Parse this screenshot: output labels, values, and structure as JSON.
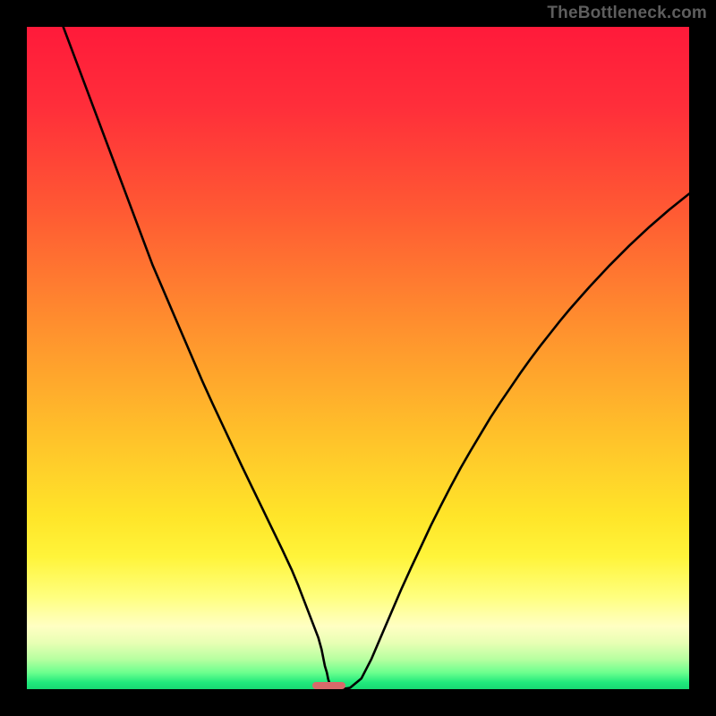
{
  "brand_text": "TheBottleneck.com",
  "colors": {
    "frame": "#000000",
    "curve_stroke": "#000000",
    "marker_fill": "#d86a6a",
    "brand_text": "#5e5e5e",
    "gradient_stops": [
      {
        "offset": 0.0,
        "color": "#ff1a3a"
      },
      {
        "offset": 0.12,
        "color": "#ff2e3a"
      },
      {
        "offset": 0.28,
        "color": "#ff5a33"
      },
      {
        "offset": 0.45,
        "color": "#ff8f2e"
      },
      {
        "offset": 0.62,
        "color": "#ffc22a"
      },
      {
        "offset": 0.74,
        "color": "#ffe529"
      },
      {
        "offset": 0.8,
        "color": "#fff43a"
      },
      {
        "offset": 0.86,
        "color": "#ffff7e"
      },
      {
        "offset": 0.905,
        "color": "#ffffc3"
      },
      {
        "offset": 0.93,
        "color": "#e8ffb4"
      },
      {
        "offset": 0.955,
        "color": "#b6ffa0"
      },
      {
        "offset": 0.975,
        "color": "#6cff8e"
      },
      {
        "offset": 0.99,
        "color": "#20e97c"
      },
      {
        "offset": 1.0,
        "color": "#18d973"
      }
    ]
  },
  "chart_data": {
    "type": "line",
    "title": "",
    "xlabel": "",
    "ylabel": "",
    "xlim": [
      0,
      1
    ],
    "ylim": [
      0,
      1
    ],
    "x": [
      0.055,
      0.07,
      0.085,
      0.1,
      0.115,
      0.13,
      0.145,
      0.16,
      0.175,
      0.19,
      0.205,
      0.22,
      0.235,
      0.25,
      0.265,
      0.28,
      0.295,
      0.31,
      0.325,
      0.34,
      0.355,
      0.37,
      0.385,
      0.4,
      0.41,
      0.415,
      0.42,
      0.425,
      0.43,
      0.435,
      0.44,
      0.445,
      0.448,
      0.45,
      0.453,
      0.455,
      0.46,
      0.465,
      0.47,
      0.475,
      0.488,
      0.505,
      0.52,
      0.535,
      0.55,
      0.565,
      0.58,
      0.595,
      0.61,
      0.625,
      0.64,
      0.655,
      0.67,
      0.685,
      0.7,
      0.715,
      0.73,
      0.745,
      0.76,
      0.775,
      0.79,
      0.805,
      0.82,
      0.835,
      0.85,
      0.865,
      0.88,
      0.895,
      0.91,
      0.925,
      0.94,
      0.955,
      0.97,
      0.985,
      1.0
    ],
    "values": [
      1.0,
      0.96,
      0.92,
      0.88,
      0.84,
      0.8,
      0.76,
      0.72,
      0.68,
      0.64,
      0.605,
      0.57,
      0.535,
      0.5,
      0.465,
      0.432,
      0.4,
      0.368,
      0.336,
      0.305,
      0.274,
      0.243,
      0.212,
      0.18,
      0.156,
      0.143,
      0.13,
      0.117,
      0.104,
      0.091,
      0.078,
      0.06,
      0.045,
      0.035,
      0.025,
      0.015,
      0.0,
      0.0,
      0.0,
      0.0,
      0.002,
      0.016,
      0.045,
      0.08,
      0.115,
      0.15,
      0.183,
      0.215,
      0.247,
      0.277,
      0.306,
      0.334,
      0.36,
      0.385,
      0.41,
      0.433,
      0.455,
      0.477,
      0.498,
      0.518,
      0.537,
      0.556,
      0.574,
      0.591,
      0.608,
      0.624,
      0.64,
      0.655,
      0.67,
      0.684,
      0.698,
      0.711,
      0.724,
      0.736,
      0.748
    ],
    "marker": {
      "x_center": 0.456,
      "y": 0.0,
      "width_frac": 0.05
    }
  }
}
